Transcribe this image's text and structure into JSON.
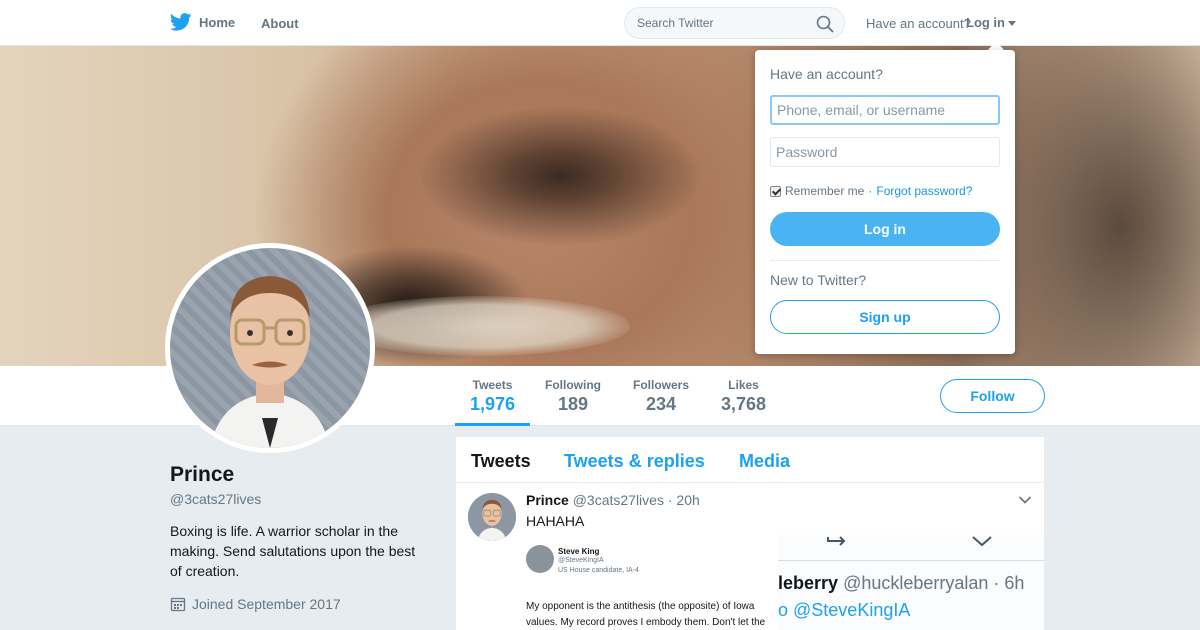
{
  "colors": {
    "brand": "#1da1f2",
    "login_button": "#4ab3f4",
    "page_background": "#e6ecf0"
  },
  "nav": {
    "logo_icon": "twitter-bird-icon",
    "home_label": "Home",
    "about_label": "About",
    "search_placeholder": "Search Twitter",
    "search_icon": "search-icon",
    "have_account": "Have an account?",
    "login_label": "Log in"
  },
  "login_dropdown": {
    "title": "Have an account?",
    "username_placeholder": "Phone, email, or username",
    "password_placeholder": "Password",
    "remember_checked": true,
    "remember_label": "Remember me",
    "separator": "·",
    "forgot_label": "Forgot password?",
    "login_button": "Log in",
    "new_to": "New to Twitter?",
    "signup_button": "Sign up"
  },
  "profile_nav": {
    "stats": [
      {
        "label": "Tweets",
        "value": "1,976",
        "active": true
      },
      {
        "label": "Following",
        "value": "189"
      },
      {
        "label": "Followers",
        "value": "234"
      },
      {
        "label": "Likes",
        "value": "3,768"
      }
    ],
    "follow_label": "Follow"
  },
  "profile": {
    "name": "Prince",
    "handle": "@3cats27lives",
    "bio": "Boxing is life. A warrior scholar in the making. Send salutations upon the best of creation.",
    "joined_icon": "calendar-icon",
    "joined": "Joined September 2017"
  },
  "timeline": {
    "tabs": [
      {
        "label": "Tweets",
        "active": true
      },
      {
        "label": "Tweets & replies"
      },
      {
        "label": "Media"
      }
    ],
    "tweet": {
      "name": "Prince",
      "handle": "@3cats27lives",
      "separator": "·",
      "time": "20h",
      "text": "HAHAHA",
      "media": {
        "embed_name": "Steve King",
        "embed_handle": "@SteveKingIA",
        "embed_subtitle": "US House candidate, IA-4",
        "embed_body": "My opponent is the antithesis (the opposite) of Iowa values. My record proves I embody them. Don't let the",
        "right_name": "leberry",
        "right_handle": "@huckleberryalan · 6h",
        "right_mention": "o @SteveKingIA"
      }
    }
  }
}
